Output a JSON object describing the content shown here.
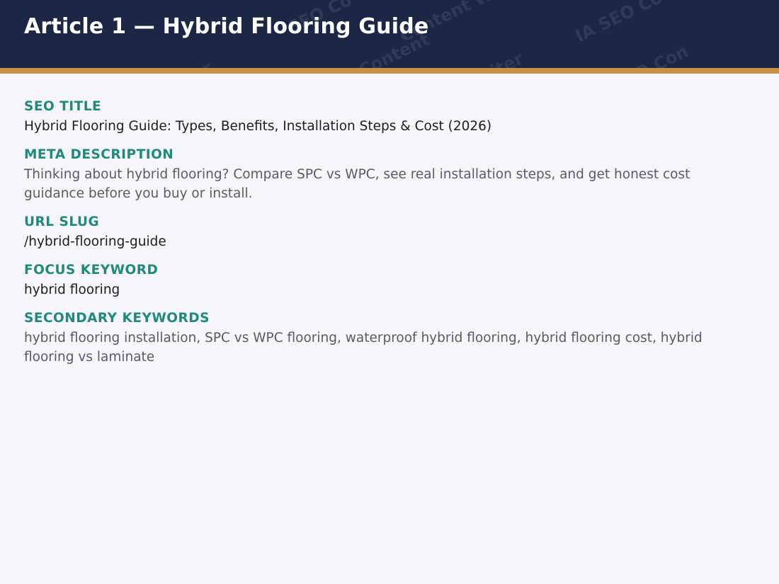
{
  "header": {
    "title": "Article 1 — Hybrid Flooring Guide",
    "watermark": [
      "SEO Co",
      "Content Writer",
      "IA SEO Co",
      "riter",
      "SEO Content",
      "Writer",
      "SEO Con"
    ]
  },
  "fields": [
    {
      "label": "SEO TITLE",
      "value": "Hybrid Flooring Guide: Types, Benefits, Installation Steps & Cost (2026)"
    },
    {
      "label": "META DESCRIPTION",
      "value": "Thinking about hybrid flooring? Compare SPC vs WPC, see real installation steps, and get honest cost guidance before you buy or install."
    },
    {
      "label": "URL SLUG",
      "value": "/hybrid-flooring-guide"
    },
    {
      "label": "FOCUS KEYWORD",
      "value": "hybrid flooring"
    },
    {
      "label": "SECONDARY KEYWORDS",
      "value": "hybrid flooring installation, SPC vs WPC flooring, waterproof hybrid flooring, hybrid flooring cost, hybrid flooring vs laminate"
    }
  ],
  "colors": {
    "header_bg": "#1b2744",
    "accent_bar": "#c4914a",
    "label": "#1f8a7c",
    "page_bg": "#f6f5fb"
  }
}
